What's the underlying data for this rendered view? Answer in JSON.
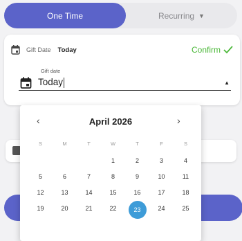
{
  "toggle": {
    "one_time": "One Time",
    "recurring": "Recurring",
    "recurring_caret": "▼"
  },
  "gift_card": {
    "header_label": "Gift Date",
    "header_value": "Today",
    "confirm_label": "Confirm",
    "field_label": "Gift date",
    "field_value": "Today",
    "dropdown_arrow": "▲"
  },
  "calendar": {
    "month_title": "April 2026",
    "prev": "‹",
    "next": "›",
    "weekdays": [
      "S",
      "M",
      "T",
      "W",
      "T",
      "F",
      "S"
    ],
    "weeks": [
      [
        "",
        "",
        "",
        "1",
        "2",
        "3",
        "4"
      ],
      [
        "5",
        "6",
        "7",
        "8",
        "9",
        "10",
        "11"
      ],
      [
        "12",
        "13",
        "14",
        "15",
        "16",
        "17",
        "18"
      ],
      [
        "19",
        "20",
        "21",
        "22",
        "23",
        "24",
        "25"
      ]
    ],
    "selected_day": "23"
  },
  "colors": {
    "accent": "#5b63c9",
    "confirm": "#4cb83a",
    "selected_day": "#3e9cd8"
  }
}
